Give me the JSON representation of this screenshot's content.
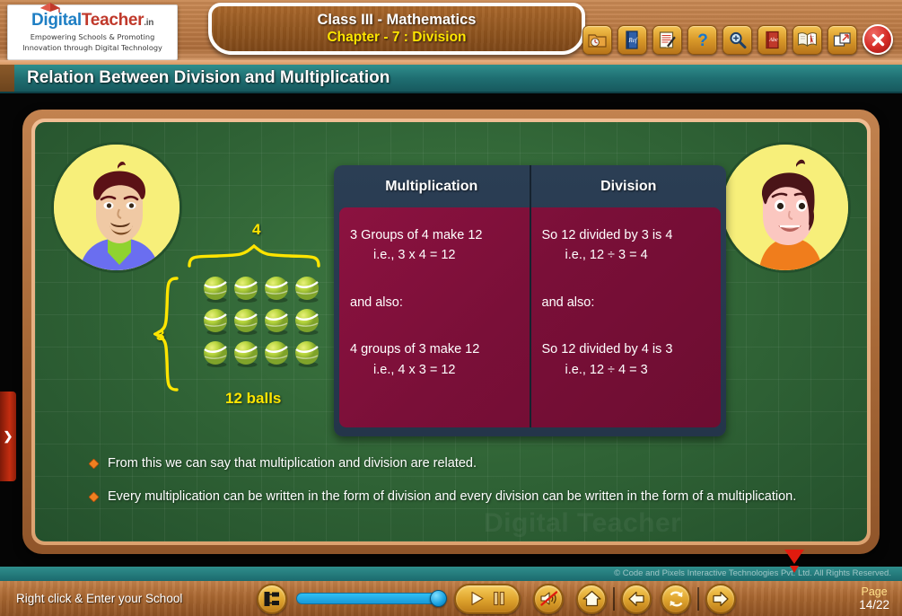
{
  "logo": {
    "name_part1": "Digital",
    "name_part2": "Teacher",
    "tld": ".in",
    "tagline_line1": "Empowering Schools & Promoting",
    "tagline_line2": "Innovation through Digital Technology"
  },
  "header": {
    "class_subject": "Class III - Mathematics",
    "chapter": "Chapter - 7 : Division",
    "page_title": "Relation Between Division and Multiplication"
  },
  "toolbar": {
    "items": [
      {
        "name": "folder-clock-icon",
        "label": "Contents"
      },
      {
        "name": "reference-book-icon",
        "label": "Reference"
      },
      {
        "name": "notepad-pen-icon",
        "label": "Notes"
      },
      {
        "name": "question-mark-icon",
        "label": "Help"
      },
      {
        "name": "magnifier-icon",
        "label": "Zoom"
      },
      {
        "name": "dictionary-icon",
        "label": "Dictionary"
      },
      {
        "name": "open-book-icon",
        "label": "Glossary"
      },
      {
        "name": "window-restore-icon",
        "label": "Restore"
      }
    ],
    "close_label": "Close"
  },
  "diagram": {
    "top_label": "4",
    "left_label": "3",
    "caption": "12 balls",
    "rows": 3,
    "columns": 4,
    "accent_color": "#ffe500"
  },
  "table": {
    "headers": [
      "Multiplication",
      "Division"
    ],
    "multiplication": {
      "line1": "3 Groups of 4 make 12",
      "line2": "i.e., 3 x 4 = 12",
      "line3": "and also:",
      "line4": "4 groups of 3 make 12",
      "line5": "i.e., 4 x 3 = 12"
    },
    "division": {
      "line1": "So 12 divided by 3 is 4",
      "line2": "i.e., 12 ÷ 3 = 4",
      "line3": "and also:",
      "line4": "So 12 divided by 4 is 3",
      "line5": "i.e., 12 ÷ 4 = 3"
    },
    "header_color": "#2b3e54",
    "body_color": "#8c1240"
  },
  "bullets": [
    "From this we can say that multiplication and division are related.",
    "Every multiplication can be written in the form of division and every division can be written in the form of a multiplication."
  ],
  "watermark": "Digital Teacher",
  "pulltab": {
    "glyph": "❯"
  },
  "footer": {
    "copyright": "© Code and Pixels Interactive Technologies  Pvt. Ltd. All Rights Reserved.",
    "school_prompt": "Right click & Enter your School",
    "page_label": "Page",
    "page_value": "14/22",
    "progress_percent": 100,
    "controls": [
      {
        "name": "index-tree-button",
        "label": "Index"
      },
      {
        "name": "play-pause-button",
        "label": "Play / Pause"
      },
      {
        "name": "mute-button",
        "label": "Sound Muted"
      },
      {
        "name": "home-button",
        "label": "Home"
      },
      {
        "name": "previous-button",
        "label": "Previous"
      },
      {
        "name": "replay-button",
        "label": "Replay"
      },
      {
        "name": "next-button",
        "label": "Next"
      }
    ]
  }
}
